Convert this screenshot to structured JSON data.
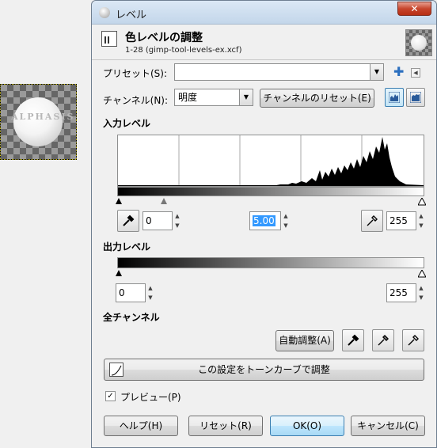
{
  "canvas_preview": {
    "text": "ALPHASIS"
  },
  "window": {
    "title": "レベル",
    "close_glyph": "✕"
  },
  "header": {
    "title": "色レベルの調整",
    "subtitle": "1-28 (gimp-tool-levels-ex.xcf)"
  },
  "preset": {
    "label": "プリセット(S):",
    "value": ""
  },
  "channel": {
    "label": "チャンネル(N):",
    "value": "明度",
    "reset_label": "チャンネルのリセット(E)"
  },
  "input_levels": {
    "heading": "入力レベル",
    "low": "0",
    "gamma": "5.00",
    "high": "255",
    "low_marker_fraction": 0.0,
    "gamma_marker_fraction": 0.15,
    "high_marker_fraction": 1.0
  },
  "output_levels": {
    "heading": "出力レベル",
    "low": "0",
    "high": "255"
  },
  "all_channels": {
    "heading": "全チャンネル",
    "auto_label": "自動調整(A)"
  },
  "curves_button": {
    "label": "この設定をトーンカーブで調整"
  },
  "preview": {
    "label": "プレビュー(P)",
    "checked": true,
    "check_glyph": "✓"
  },
  "buttons": {
    "help": "ヘルプ(H)",
    "reset": "リセット(R)",
    "ok": "OK(O)",
    "cancel": "キャンセル(C)"
  },
  "colors": {
    "accent": "#3399ff",
    "default_button_border": "#3c7fb1",
    "close_red": "#c7452c"
  }
}
